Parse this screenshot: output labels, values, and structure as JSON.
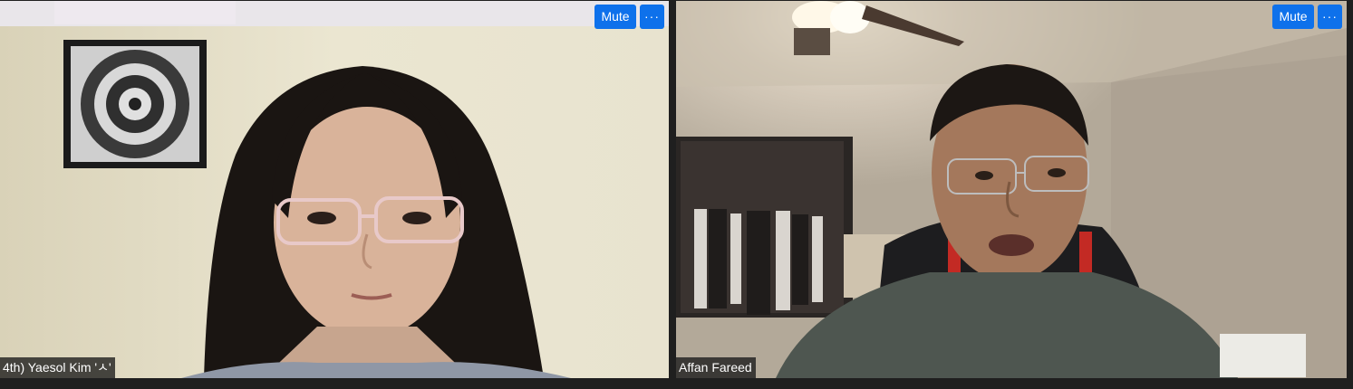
{
  "participants": [
    {
      "name": "4th) Yaesol Kim 'ㅅ'",
      "mute_label": "Mute",
      "more_label": "···",
      "more_icon": "ellipsis-icon"
    },
    {
      "name": "Affan Fareed",
      "mute_label": "Mute",
      "more_label": "···",
      "more_icon": "ellipsis-icon"
    }
  ],
  "colors": {
    "button_blue": "#0e71eb",
    "background": "#1f1f1f",
    "label_bg": "#191919"
  }
}
